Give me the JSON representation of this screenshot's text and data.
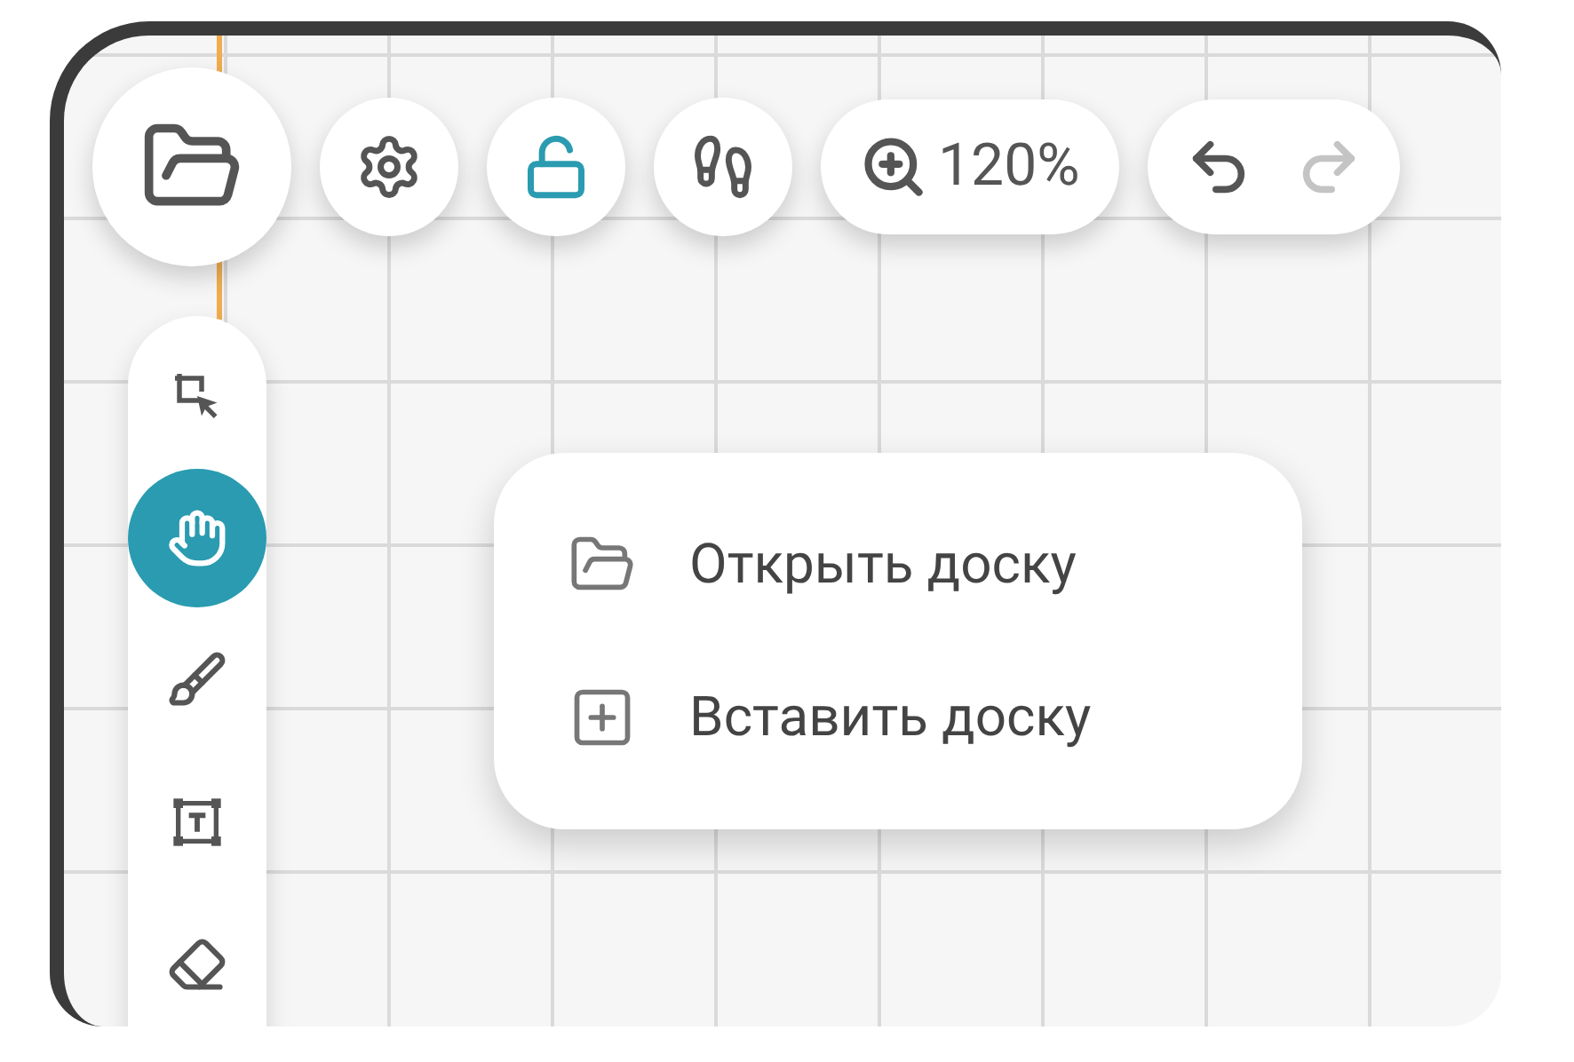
{
  "toolbar": {
    "buttons": [
      {
        "kind": "file"
      },
      {
        "kind": "settings"
      },
      {
        "kind": "lock",
        "locked": false
      },
      {
        "kind": "steps"
      }
    ],
    "zoom": {
      "value": "120%"
    },
    "history": [
      {
        "kind": "undo",
        "disabled": false
      },
      {
        "kind": "redo",
        "disabled": true
      }
    ]
  },
  "tools": [
    {
      "kind": "select",
      "selected": false
    },
    {
      "kind": "hand",
      "selected": true
    },
    {
      "kind": "brush",
      "selected": false
    },
    {
      "kind": "text",
      "selected": false
    },
    {
      "kind": "eraser",
      "selected": false
    }
  ],
  "menu": {
    "items": [
      {
        "kind": "open",
        "label": "Открыть доску"
      },
      {
        "kind": "insert",
        "label": "Вставить доску"
      }
    ]
  }
}
